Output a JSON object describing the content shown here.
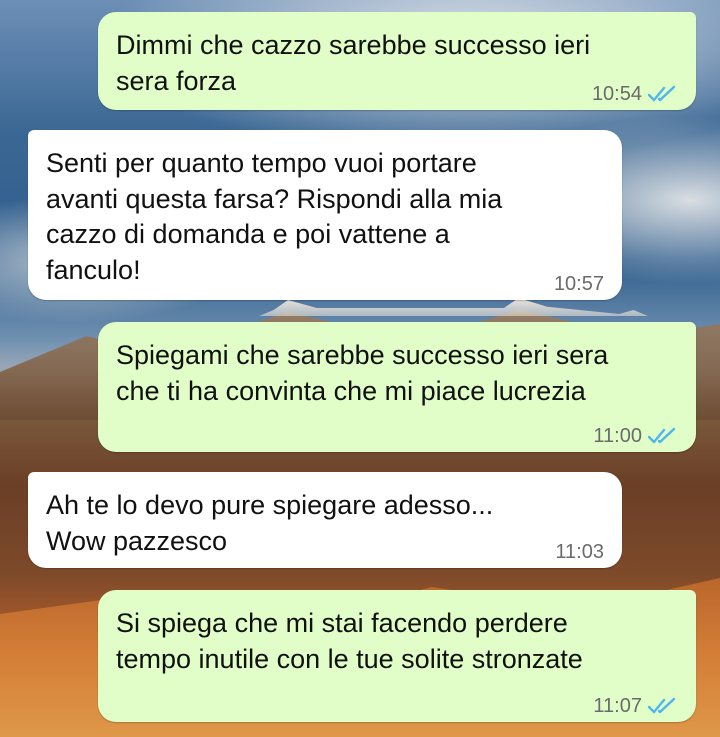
{
  "colors": {
    "outgoing_bubble": "#e1fec8",
    "incoming_bubble": "#ffffff",
    "read_ticks": "#4fb6ec",
    "timestamp": "#6b6b6b"
  },
  "messages": [
    {
      "direction": "outgoing",
      "text": "Dimmi che cazzo sarebbe successo ieri\nsera forza",
      "time": "10:54",
      "status_icon": "double-check-read-icon"
    },
    {
      "direction": "incoming",
      "text": "Senti per quanto tempo vuoi portare\navanti questa farsa? Rispondi alla mia\ncazzo di domanda e poi vattene a\nfanculo!",
      "time": "10:57"
    },
    {
      "direction": "outgoing",
      "text": "Spiegami che sarebbe successo ieri sera\nche ti ha convinta che mi piace lucrezia",
      "time": "11:00",
      "status_icon": "double-check-read-icon"
    },
    {
      "direction": "incoming",
      "text": "Ah te lo devo pure spiegare adesso...\nWow pazzesco",
      "time": "11:03"
    },
    {
      "direction": "outgoing",
      "text": "Si spiega che mi stai facendo perdere\ntempo inutile con le tue solite stronzate",
      "time": "11:07",
      "status_icon": "double-check-read-icon"
    }
  ]
}
